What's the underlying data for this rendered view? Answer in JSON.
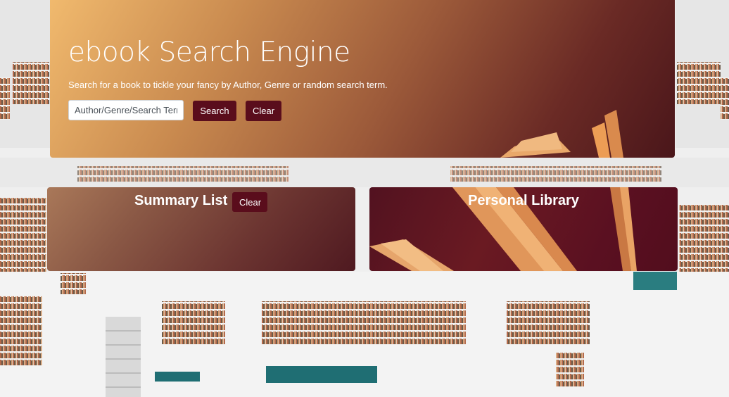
{
  "header": {
    "title": "ebook Search Engine",
    "subtitle": "Search for a book to tickle your fancy by Author, Genre or random search term.",
    "search_placeholder": "Author/Genre/Search Term",
    "search_label": "Search",
    "clear_label": "Clear"
  },
  "summary": {
    "title": "Summary List",
    "clear_label": "Clear"
  },
  "library": {
    "title": "Personal Library"
  },
  "colors": {
    "button": "#5a0d1c",
    "jumbotron_start": "#f1ba6e",
    "jumbotron_end": "#4a161a"
  },
  "icons": {
    "background": "library-interior-image",
    "decoration": "open-book-image"
  }
}
